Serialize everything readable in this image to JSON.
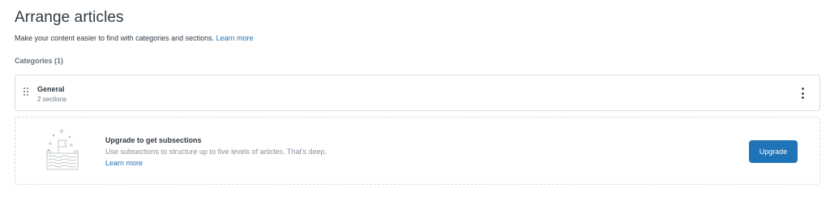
{
  "header": {
    "title": "Arrange articles",
    "description": "Make your content easier to find with categories and sections.",
    "learn_more": "Learn more"
  },
  "categories": {
    "label": "Categories (1)",
    "items": [
      {
        "name": "General",
        "subtitle": "2 sections"
      }
    ]
  },
  "upsell": {
    "title": "Upgrade to get subsections",
    "text": "Use subsections to structure up to five levels of articles. That's deep.",
    "learn_more": "Learn more",
    "button_label": "Upgrade"
  },
  "colors": {
    "primary": "#1f73b7",
    "border": "#d8dcde",
    "text": "#2f3941",
    "muted": "#68737d"
  },
  "icons": {
    "drag_handle": "drag-handle-icon",
    "more_options": "kebab-icon",
    "illustration": "flag-castle-illustration"
  }
}
